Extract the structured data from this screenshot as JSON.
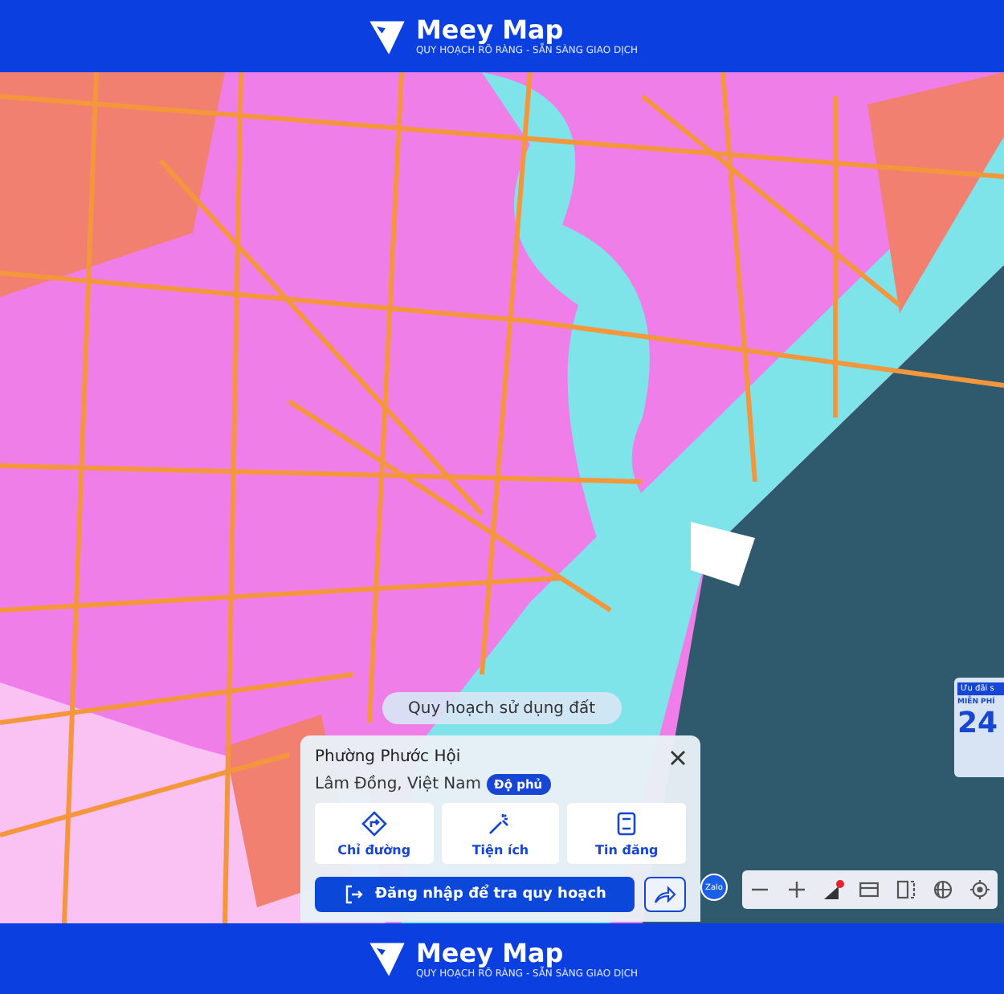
{
  "header": {
    "brand": "Meey Map",
    "tagline": "QUY HOẠCH RÕ RÀNG - SẴN SÀNG GIAO DỊCH"
  },
  "map": {
    "layer_button": "Quy hoạch sử dụng đất"
  },
  "promo": {
    "tag": "Ưu đãi s",
    "headline": "MIỄN PHÍ",
    "number": "24"
  },
  "place_card": {
    "name": "Phường Phước Hội",
    "region": "Lâm Đồng, Việt Nam",
    "badge": "Độ phủ",
    "actions": [
      {
        "kind": "directions",
        "label": "Chỉ đường"
      },
      {
        "kind": "amenities",
        "label": "Tiện ích"
      },
      {
        "kind": "listings",
        "label": "Tin đăng"
      }
    ],
    "login_button": "Đăng nhập để tra quy hoạch"
  },
  "zalo": "Zalo",
  "toolbar": [
    {
      "kind": "zoom-out"
    },
    {
      "kind": "zoom-in"
    },
    {
      "kind": "layers",
      "alert": true
    },
    {
      "kind": "ruler"
    },
    {
      "kind": "split"
    },
    {
      "kind": "globe"
    },
    {
      "kind": "locate"
    }
  ],
  "footer": {
    "brand": "Meey Map",
    "tagline": "QUY HOẠCH RÕ RÀNG - SẴN SÀNG GIAO DỊCH"
  }
}
